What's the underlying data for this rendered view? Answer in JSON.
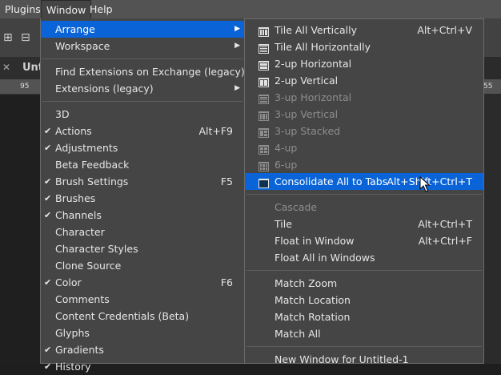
{
  "menubar": [
    {
      "label": "Plugins",
      "active": false
    },
    {
      "label": "Window",
      "active": true
    },
    {
      "label": "Help",
      "active": false
    }
  ],
  "background": {
    "tab_text": "Unt",
    "ruler_numbers": [
      "95",
      "55"
    ]
  },
  "window_menu": [
    {
      "label": "Arrange",
      "highlighted": true,
      "submenu": true
    },
    {
      "label": "Workspace",
      "submenu": true
    },
    {
      "sep": true
    },
    {
      "label": "Find Extensions on Exchange (legacy)..."
    },
    {
      "label": "Extensions (legacy)",
      "submenu": true
    },
    {
      "sep": true
    },
    {
      "label": "3D"
    },
    {
      "label": "Actions",
      "checked": true,
      "shortcut": "Alt+F9"
    },
    {
      "label": "Adjustments",
      "checked": true
    },
    {
      "label": "Beta Feedback"
    },
    {
      "label": "Brush Settings",
      "checked": true,
      "shortcut": "F5"
    },
    {
      "label": "Brushes",
      "checked": true
    },
    {
      "label": "Channels",
      "checked": true
    },
    {
      "label": "Character"
    },
    {
      "label": "Character Styles"
    },
    {
      "label": "Clone Source"
    },
    {
      "label": "Color",
      "checked": true,
      "shortcut": "F6"
    },
    {
      "label": "Comments"
    },
    {
      "label": "Content Credentials (Beta)"
    },
    {
      "label": "Glyphs"
    },
    {
      "label": "Gradients",
      "checked": true
    },
    {
      "label": "History",
      "checked": true
    }
  ],
  "arrange_menu": [
    {
      "label": "Tile All Vertically",
      "shortcut": "Alt+Ctrl+V",
      "icon": "tile-vertical-icon"
    },
    {
      "label": "Tile All Horizontally",
      "icon": "tile-horizontal-icon"
    },
    {
      "label": "2-up Horizontal",
      "icon": "2up-horizontal-icon"
    },
    {
      "label": "2-up Vertical",
      "icon": "2up-vertical-icon"
    },
    {
      "label": "3-up Horizontal",
      "disabled": true,
      "icon": "3up-horizontal-icon"
    },
    {
      "label": "3-up Vertical",
      "disabled": true,
      "icon": "3up-vertical-icon"
    },
    {
      "label": "3-up Stacked",
      "disabled": true,
      "icon": "3up-stacked-icon"
    },
    {
      "label": "4-up",
      "disabled": true,
      "icon": "4up-icon"
    },
    {
      "label": "6-up",
      "disabled": true,
      "icon": "6up-icon"
    },
    {
      "label": "Consolidate All to Tabs",
      "shortcut": "Alt+Shift+Ctrl+T",
      "highlighted": true,
      "icon": "consolidate-tabs-icon"
    },
    {
      "sep": true
    },
    {
      "label": "Cascade",
      "disabled": true
    },
    {
      "label": "Tile",
      "shortcut": "Alt+Ctrl+T"
    },
    {
      "label": "Float in Window",
      "shortcut": "Alt+Ctrl+F"
    },
    {
      "label": "Float All in Windows"
    },
    {
      "sep": true
    },
    {
      "label": "Match Zoom"
    },
    {
      "label": "Match Location"
    },
    {
      "label": "Match Rotation"
    },
    {
      "label": "Match All"
    },
    {
      "sep": true
    },
    {
      "label": "New Window for Untitled-1"
    }
  ],
  "colors": {
    "highlight": "#0a64d8",
    "menu_bg": "#454545",
    "menubar_bg": "#535353"
  }
}
